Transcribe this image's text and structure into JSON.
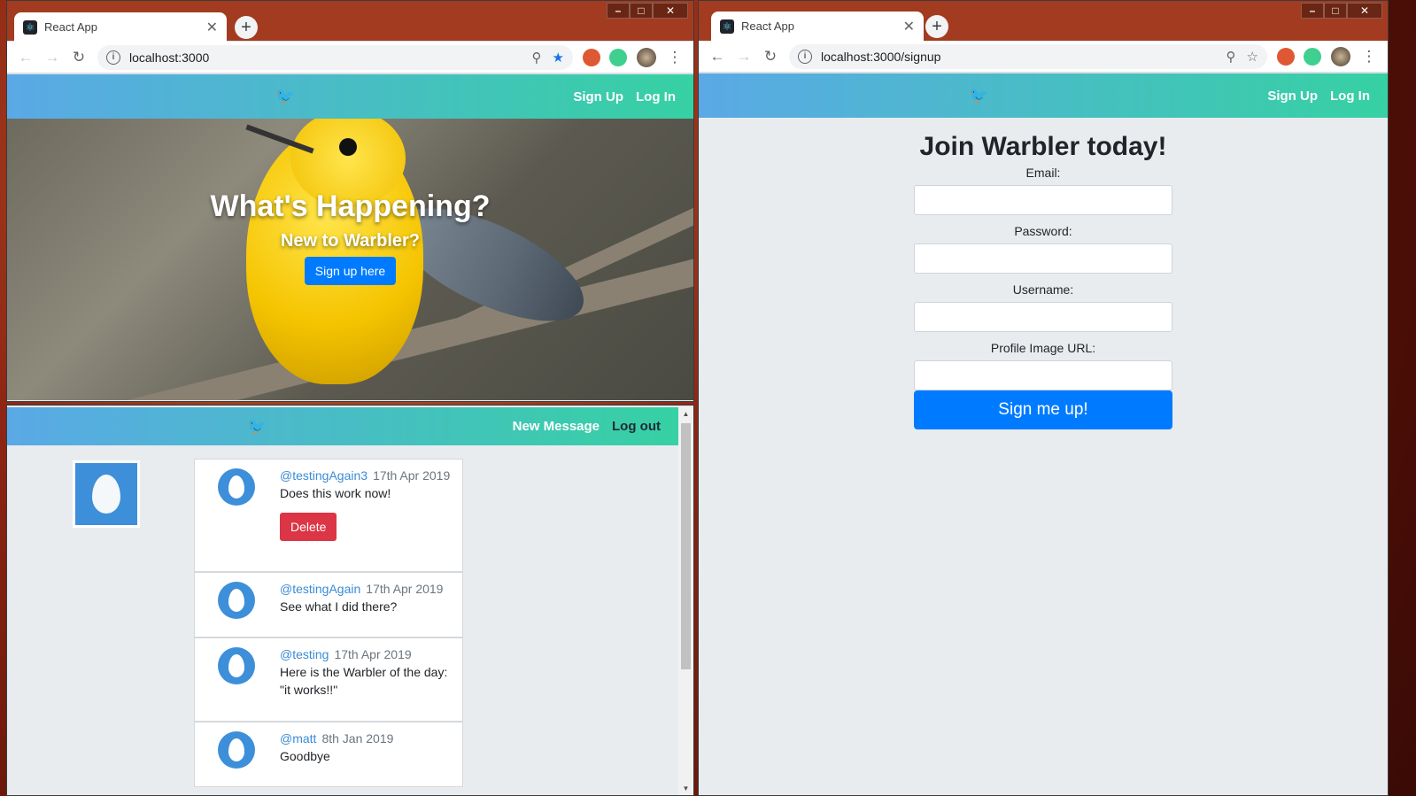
{
  "left_window": {
    "tab_title": "React App",
    "url": "localhost:3000",
    "navbar": {
      "signup": "Sign Up",
      "login": "Log In"
    },
    "hero": {
      "title": "What's Happening?",
      "subtitle": "New to Warbler?",
      "button": "Sign up here"
    }
  },
  "timeline_window": {
    "navbar": {
      "new_message": "New Message",
      "logout": "Log out"
    },
    "messages": [
      {
        "user": "@testingAgain3",
        "date": "17th Apr 2019",
        "text": "Does this work now!",
        "delete_label": "Delete"
      },
      {
        "user": "@testingAgain",
        "date": "17th Apr 2019",
        "text": "See what I did there?"
      },
      {
        "user": "@testing",
        "date": "17th Apr 2019",
        "text": "Here is the Warbler of the day: \"it works!!\""
      },
      {
        "user": "@matt",
        "date": "8th Jan 2019",
        "text": "Goodbye"
      }
    ]
  },
  "right_window": {
    "tab_title": "React App",
    "url": "localhost:3000/signup",
    "navbar": {
      "signup": "Sign Up",
      "login": "Log In"
    },
    "form": {
      "title": "Join Warbler today!",
      "email_label": "Email:",
      "password_label": "Password:",
      "username_label": "Username:",
      "image_label": "Profile Image URL:",
      "submit": "Sign me up!"
    }
  },
  "colors": {
    "navbar_start": "#5aa9e6",
    "navbar_end": "#36d1a3",
    "primary": "#007bff",
    "danger": "#dc3545",
    "username_link": "#3a8bd6"
  }
}
